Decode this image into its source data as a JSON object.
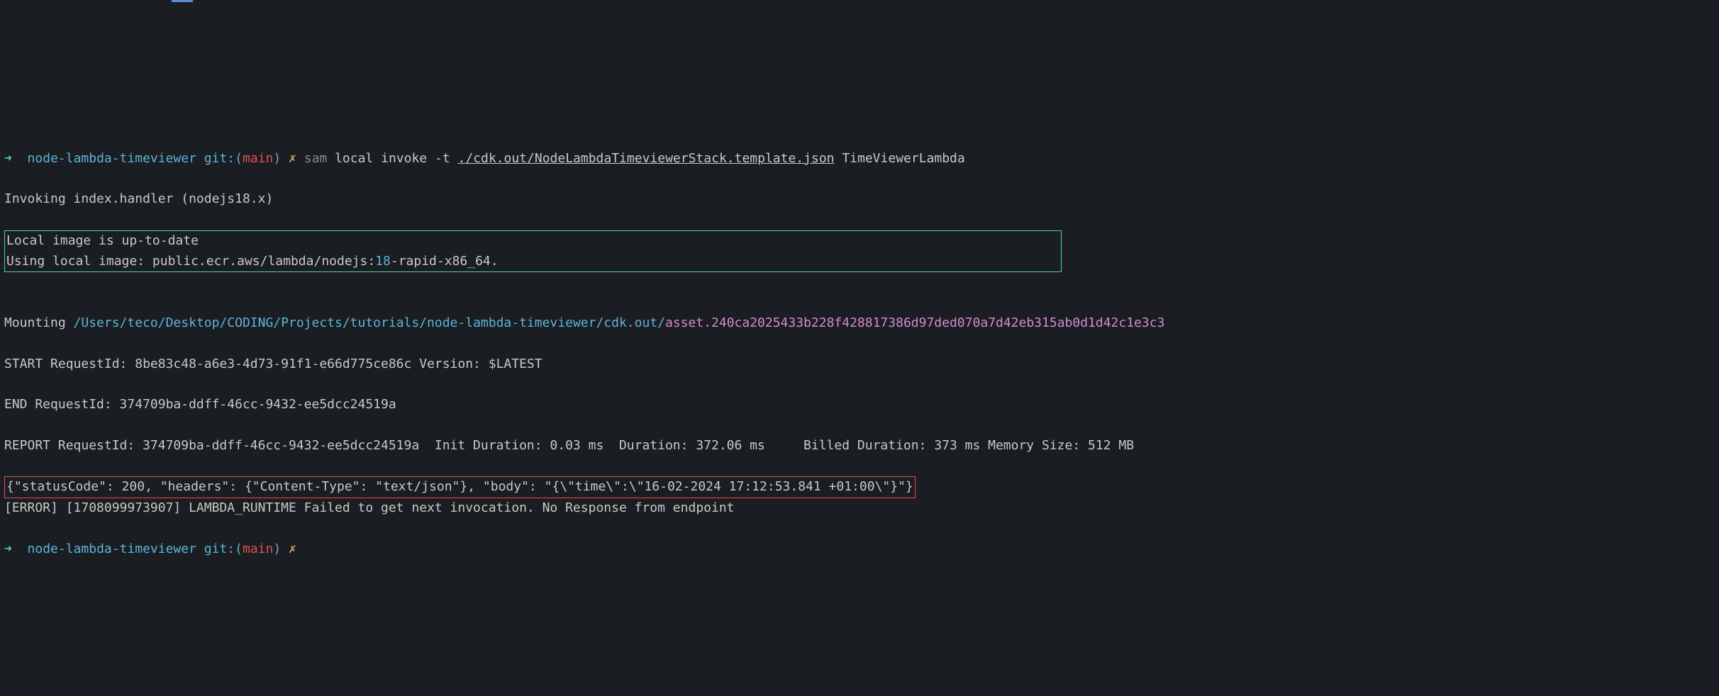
{
  "prompt1": {
    "arrow": "➜",
    "project": "node-lambda-timeviewer",
    "git": "git:",
    "paren_open": "(",
    "branch": "main",
    "paren_close": ")",
    "x": "✗",
    "sam": "sam",
    "cmd_part1": " local invoke -t ",
    "template_path": "./cdk.out/NodeLambdaTimeviewerStack.template.json",
    "lambda_name": " TimeViewerLambda"
  },
  "line_invoking": "Invoking index.handler (nodejs18.x)",
  "box_green": {
    "line1": "Local image is up-to-date",
    "line2_before": "Using local image: public.ecr.aws/lambda/nodejs:",
    "line2_num": "18",
    "line2_after": "-rapid-x86_64."
  },
  "mounting": {
    "prefix": "Mounting ",
    "path": "/Users/teco/Desktop/CODING/Projects/tutorials/node-lambda-timeviewer/cdk.out/",
    "asset": "asset.240ca2025433b228f428817386d97ded070a7d42eb315ab0d1d42c1e3c3"
  },
  "start_line": "START RequestId: 8be83c48-a6e3-4d73-91f1-e66d775ce86c Version: $LATEST",
  "end_line": "END RequestId: 374709ba-ddff-46cc-9432-ee5dcc24519a",
  "report_line": "REPORT RequestId: 374709ba-ddff-46cc-9432-ee5dcc24519a  Init Duration: 0.03 ms  Duration: 372.06 ms     Billed Duration: 373 ms Memory Size: 512 MB",
  "response_json": "{\"statusCode\": 200, \"headers\": {\"Content-Type\": \"text/json\"}, \"body\": \"{\\\"time\\\":\\\"16-02-2024 17:12:53.841 +01:00\\\"}\"}",
  "error_line": "[ERROR] [1708099973907] LAMBDA_RUNTIME Failed to get next invocation. No Response from endpoint",
  "prompt2": {
    "arrow": "➜",
    "project": "node-lambda-timeviewer",
    "git": "git:",
    "paren_open": "(",
    "branch": "main",
    "paren_close": ")",
    "x": "✗"
  }
}
